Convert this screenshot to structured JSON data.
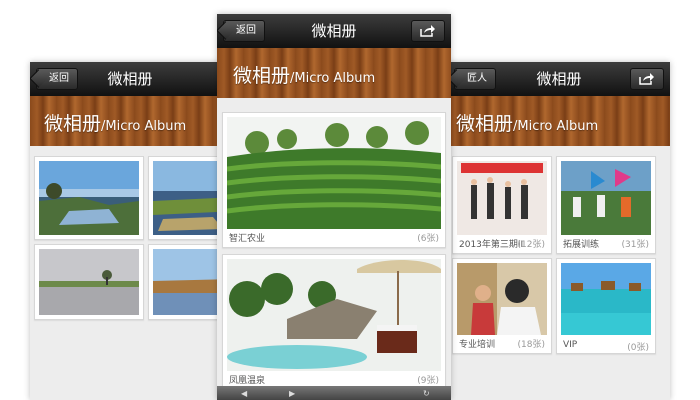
{
  "left_phone": {
    "back_label": "返回",
    "title": "微相册",
    "banner_cn": "微相册",
    "banner_en": "/Micro Album"
  },
  "center_phone": {
    "back_label": "返回",
    "title": "微相册",
    "banner_cn": "微相册",
    "banner_en": "/Micro Album",
    "albums": [
      {
        "name": "智汇农业",
        "count": "(6张)"
      },
      {
        "name": "凤凰温泉",
        "count": "(9张)"
      }
    ]
  },
  "right_phone": {
    "back_label": "匠人",
    "title": "微相册",
    "banner_cn": "微相册",
    "banner_en": "/Micro Album",
    "albums": [
      {
        "name": "2013年第三期II",
        "count": "(12张)"
      },
      {
        "name": "拓展训练",
        "count": "(31张)"
      },
      {
        "name": "专业培训",
        "count": "(18张)"
      },
      {
        "name": "VIP",
        "count": "(0张)"
      }
    ]
  },
  "icons": [
    "back-arrow-icon",
    "share-icon",
    "toolbar-icon"
  ]
}
